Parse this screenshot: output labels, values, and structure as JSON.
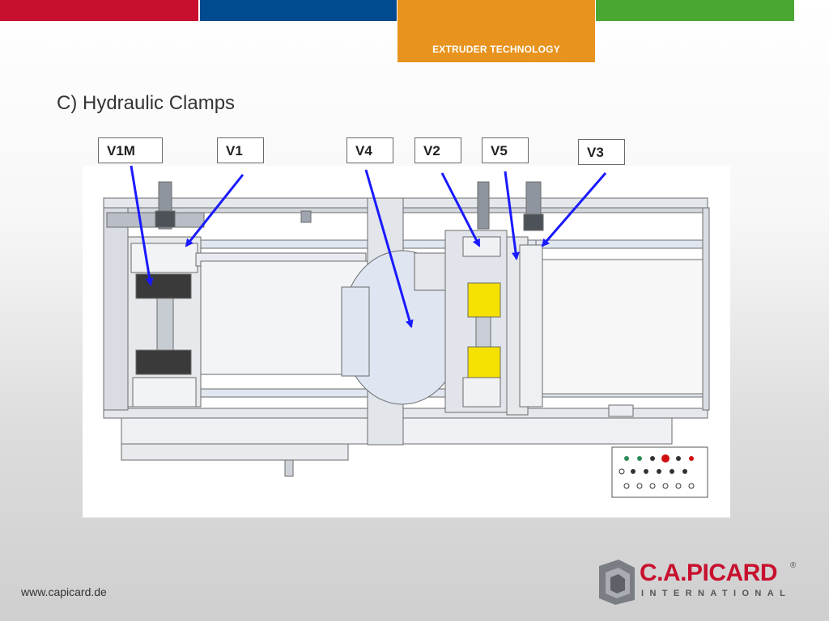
{
  "header": {
    "topic": "EXTRUDER TECHNOLOGY",
    "colors": {
      "red": "#c8102e",
      "blue": "#004a8f",
      "orange": "#e8931e",
      "green": "#4aa832"
    }
  },
  "slide": {
    "title": "C) Hydraulic Clamps"
  },
  "diagram": {
    "labels": [
      "V1M",
      "V1",
      "V4",
      "V2",
      "V5",
      "V3"
    ],
    "arrow_color": "#1a1aff",
    "cylinder_color": "#f5e100"
  },
  "footer": {
    "url": "www.capicard.de",
    "logo_main": "C.A.PICARD",
    "logo_reg": "®",
    "logo_sub": "INTERNATIONAL"
  }
}
